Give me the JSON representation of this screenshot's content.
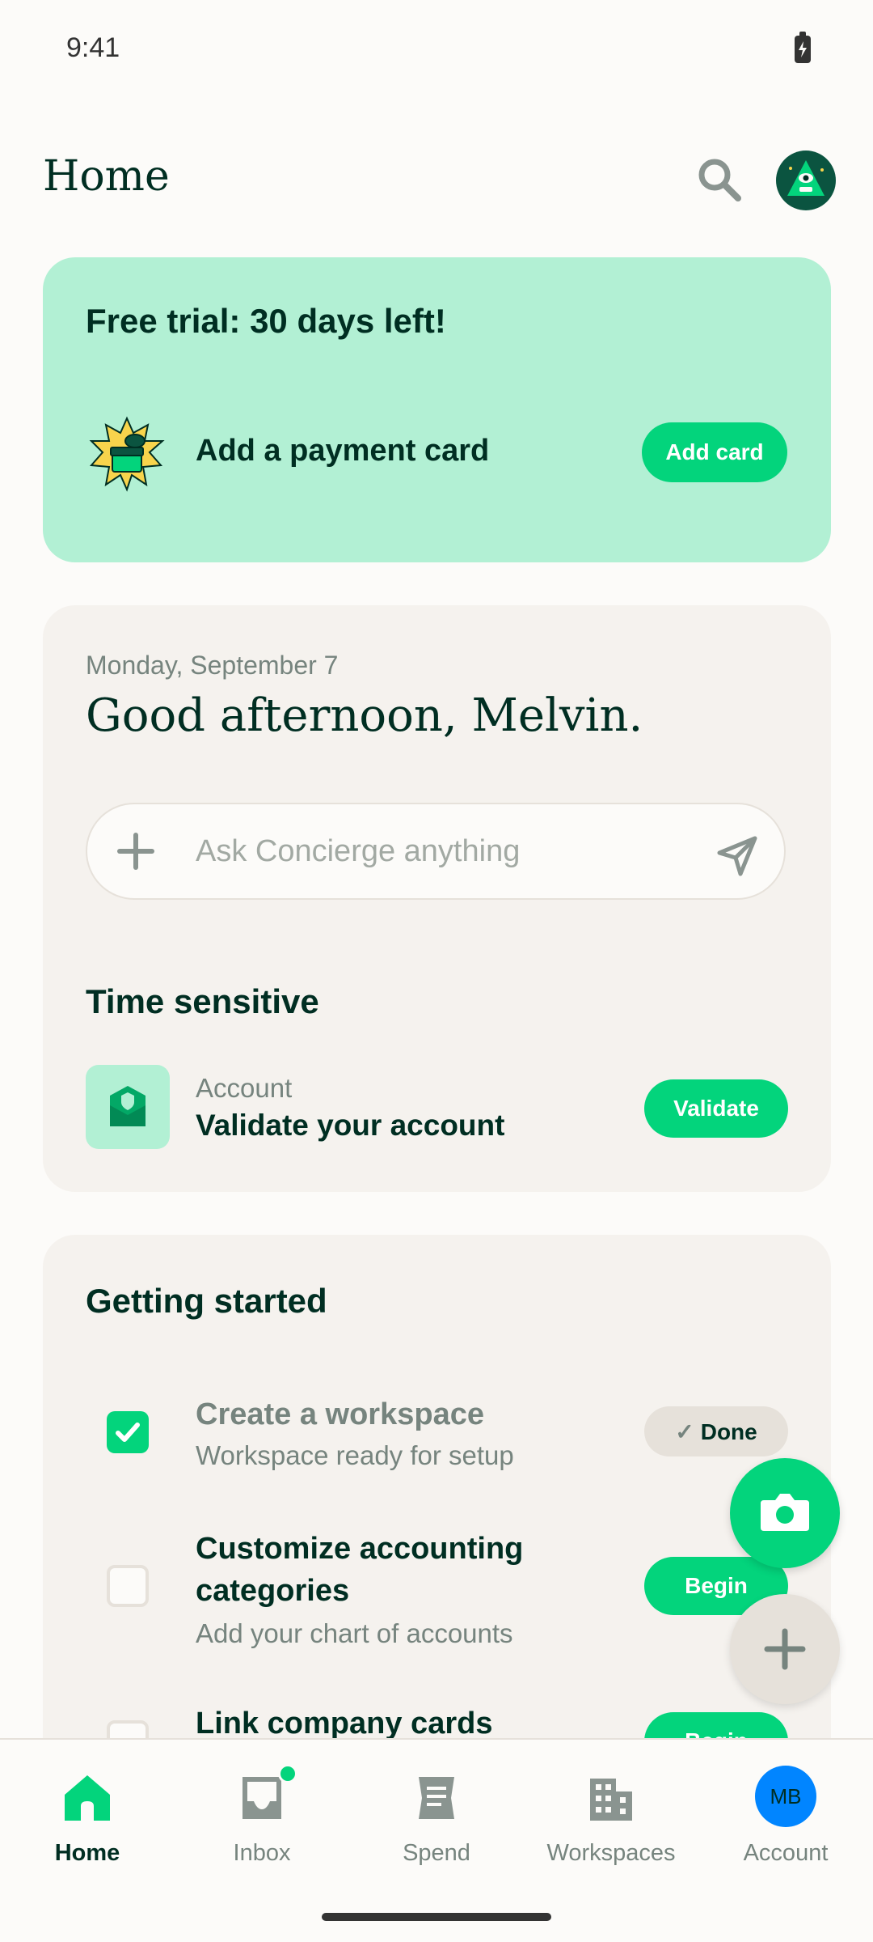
{
  "status_bar": {
    "time": "9:41"
  },
  "header": {
    "title": "Home"
  },
  "trial_card": {
    "title": "Free trial: 30 days left!",
    "item_text": "Add a payment card",
    "button_label": "Add card"
  },
  "greeting": {
    "date": "Monday, September 7",
    "title": "Good afternoon, Melvin.",
    "concierge_placeholder": "Ask Concierge anything"
  },
  "time_sensitive": {
    "title": "Time sensitive",
    "item": {
      "label": "Account",
      "text": "Validate your account",
      "button_label": "Validate"
    }
  },
  "getting_started": {
    "title": "Getting started",
    "tasks": [
      {
        "title": "Create a workspace",
        "subtitle": "Workspace ready for setup",
        "button_label": "Done",
        "completed": true
      },
      {
        "title_line1": "Customize accounting",
        "title_line2": "categories",
        "subtitle": "Add your chart of accounts",
        "button_label": "Begin",
        "completed": false
      },
      {
        "title": "Link company cards",
        "button_label": "Begin",
        "completed": false
      }
    ]
  },
  "bottom_nav": {
    "items": [
      {
        "label": "Home",
        "icon": "home-icon",
        "active": true
      },
      {
        "label": "Inbox",
        "icon": "inbox-icon",
        "active": false
      },
      {
        "label": "Spend",
        "icon": "receipt-icon",
        "active": false
      },
      {
        "label": "Workspaces",
        "icon": "building-icon",
        "active": false
      },
      {
        "label": "Account",
        "icon": "avatar",
        "active": false
      }
    ],
    "account_initials": "MB"
  },
  "colors": {
    "accent": "#03D47C",
    "trial_bg": "#B2F0D4",
    "card_bg": "#F5F2EE",
    "text_dark": "#002E22",
    "text_muted": "#76847E",
    "avatar_blue": "#0185FF"
  }
}
